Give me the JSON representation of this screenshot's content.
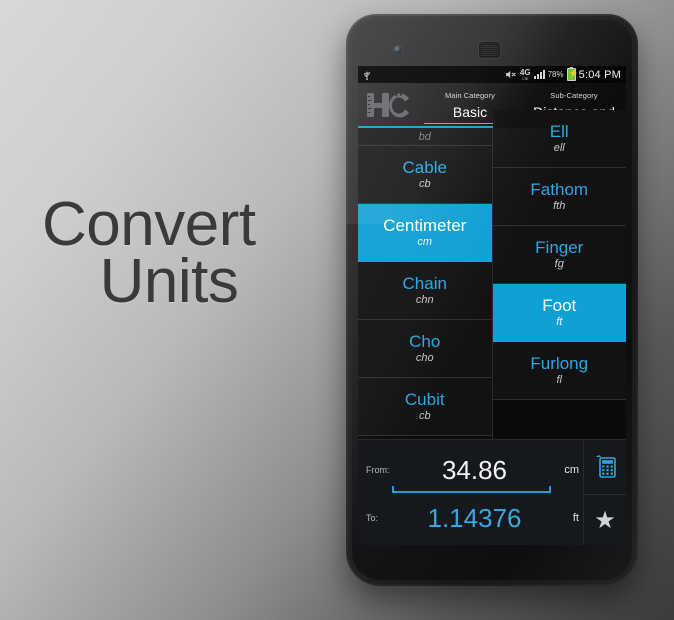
{
  "promo": {
    "line1": "Convert",
    "line2": "Units"
  },
  "statusbar": {
    "usb_icon": "usb-icon",
    "mute_icon": "mute-icon",
    "network_label": "4G",
    "network_sub": "LTE",
    "signal_icon": "signal-bars-icon",
    "battery_percent": "78%",
    "battery_icon": "battery-charging-icon",
    "clock": "5:04 PM"
  },
  "header": {
    "logo": "hc-logo",
    "main_category_label": "Main Category",
    "main_category_value": "Basic",
    "sub_category_label": "Sub-Category",
    "sub_category_value": "Distance and",
    "accent_color": "#1aa0d6"
  },
  "units": {
    "left_column": [
      {
        "name": "",
        "abbr": "bd",
        "selected": false,
        "partial": true
      },
      {
        "name": "Cable",
        "abbr": "cb",
        "selected": false,
        "partial": false
      },
      {
        "name": "Centimeter",
        "abbr": "cm",
        "selected": true,
        "partial": false
      },
      {
        "name": "Chain",
        "abbr": "chn",
        "selected": false,
        "partial": false
      },
      {
        "name": "Cho",
        "abbr": "cho",
        "selected": false,
        "partial": false
      },
      {
        "name": "Cubit",
        "abbr": "cb",
        "selected": false,
        "partial": false
      }
    ],
    "right_column": [
      {
        "name": "Ell",
        "abbr": "ell",
        "selected": false,
        "partial": false
      },
      {
        "name": "Fathom",
        "abbr": "fth",
        "selected": false,
        "partial": false
      },
      {
        "name": "Finger",
        "abbr": "fg",
        "selected": false,
        "partial": false
      },
      {
        "name": "Foot",
        "abbr": "ft",
        "selected": true,
        "partial": false
      },
      {
        "name": "Furlong",
        "abbr": "fl",
        "selected": false,
        "partial": false
      }
    ],
    "selected_color": "#0fa0d4",
    "name_color": "#28a8e0"
  },
  "convert": {
    "from_label": "From:",
    "from_value": "34.86",
    "from_unit": "cm",
    "to_label": "To:",
    "to_value": "1.14376",
    "to_unit": "ft",
    "calculator_icon": "calculator-icon",
    "favorite_icon": "star-icon",
    "star_glyph": "★"
  }
}
